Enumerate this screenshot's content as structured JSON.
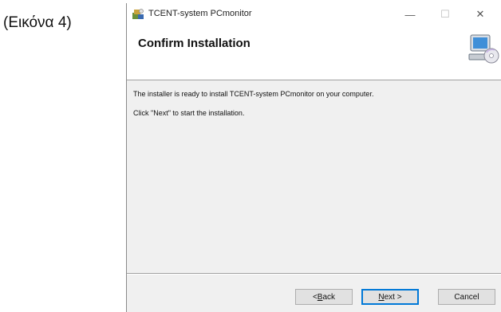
{
  "caption": "(Εικόνα 4)",
  "window": {
    "title": "TCENT-system PCmonitor",
    "controls": {
      "minimize": "—",
      "maximize": "☐",
      "close": "✕"
    }
  },
  "header": {
    "title": "Confirm Installation"
  },
  "content": {
    "line1": "The installer is ready to install TCENT-system PCmonitor on your computer.",
    "line2": "Click \"Next\" to start the installation."
  },
  "buttons": {
    "back": {
      "prefix": "< ",
      "mnemonic": "B",
      "rest": "ack"
    },
    "next": {
      "mnemonic": "N",
      "rest": "ext >"
    },
    "cancel": "Cancel"
  },
  "icons": {
    "app": "installer-icon",
    "header": "computer-cd-icon"
  },
  "colors": {
    "focus_border": "#0078d7",
    "dialog_bg": "#f0f0f0",
    "header_bg": "#ffffff"
  }
}
